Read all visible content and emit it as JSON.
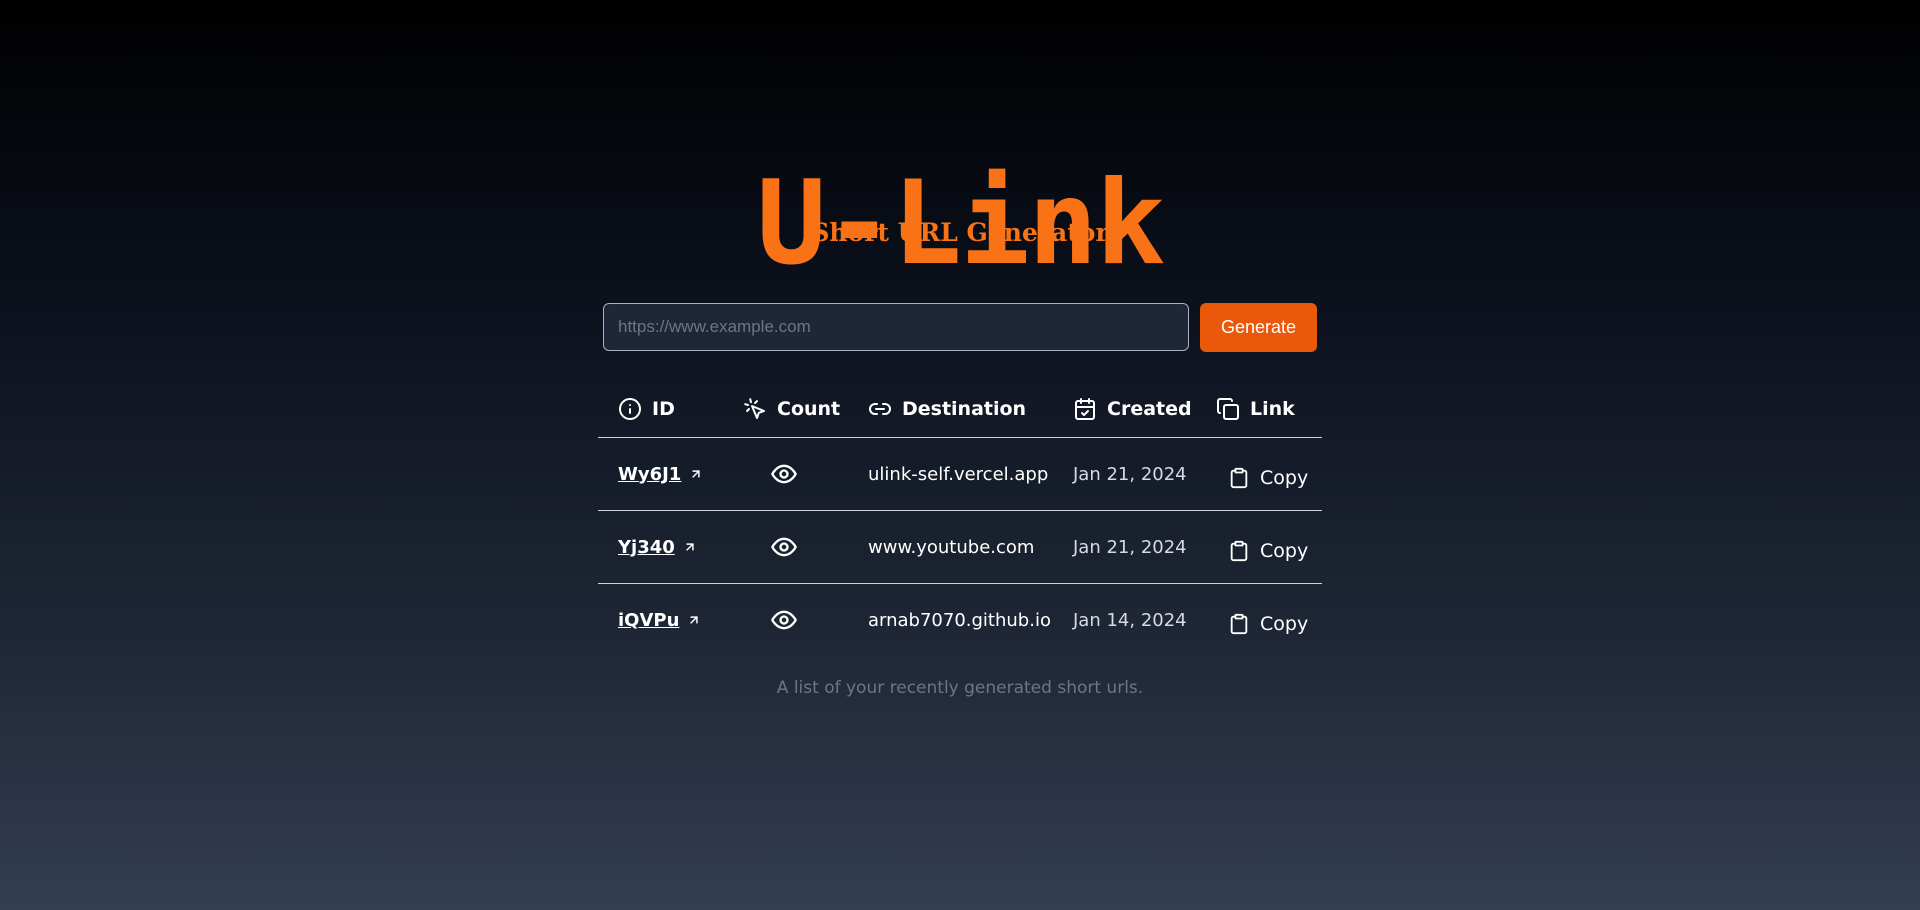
{
  "app": {
    "title": "U-Link",
    "subtitle": "Short URL Generator"
  },
  "form": {
    "placeholder": "https://www.example.com",
    "value": "",
    "generate_label": "Generate"
  },
  "table": {
    "columns": [
      {
        "label": "ID",
        "icon": "info-icon"
      },
      {
        "label": "Count",
        "icon": "cursor-click-icon"
      },
      {
        "label": "Destination",
        "icon": "link-icon"
      },
      {
        "label": "Created",
        "icon": "calendar-check-icon"
      },
      {
        "label": "Link",
        "icon": "copy-icon"
      }
    ],
    "rows": [
      {
        "id": "Wy6J1",
        "destination": "ulink-self.vercel.app",
        "created": "Jan 21, 2024",
        "copy_label": "Copy"
      },
      {
        "id": "Yj340",
        "destination": "www.youtube.com",
        "created": "Jan 21, 2024",
        "copy_label": "Copy"
      },
      {
        "id": "iQVPu",
        "destination": "arnab7070.github.io",
        "created": "Jan 14, 2024",
        "copy_label": "Copy"
      }
    ],
    "caption": "A list of your recently generated short urls."
  },
  "colors": {
    "accent": "#f97316",
    "button": "#ea580c",
    "input_bg": "#1d2737"
  }
}
